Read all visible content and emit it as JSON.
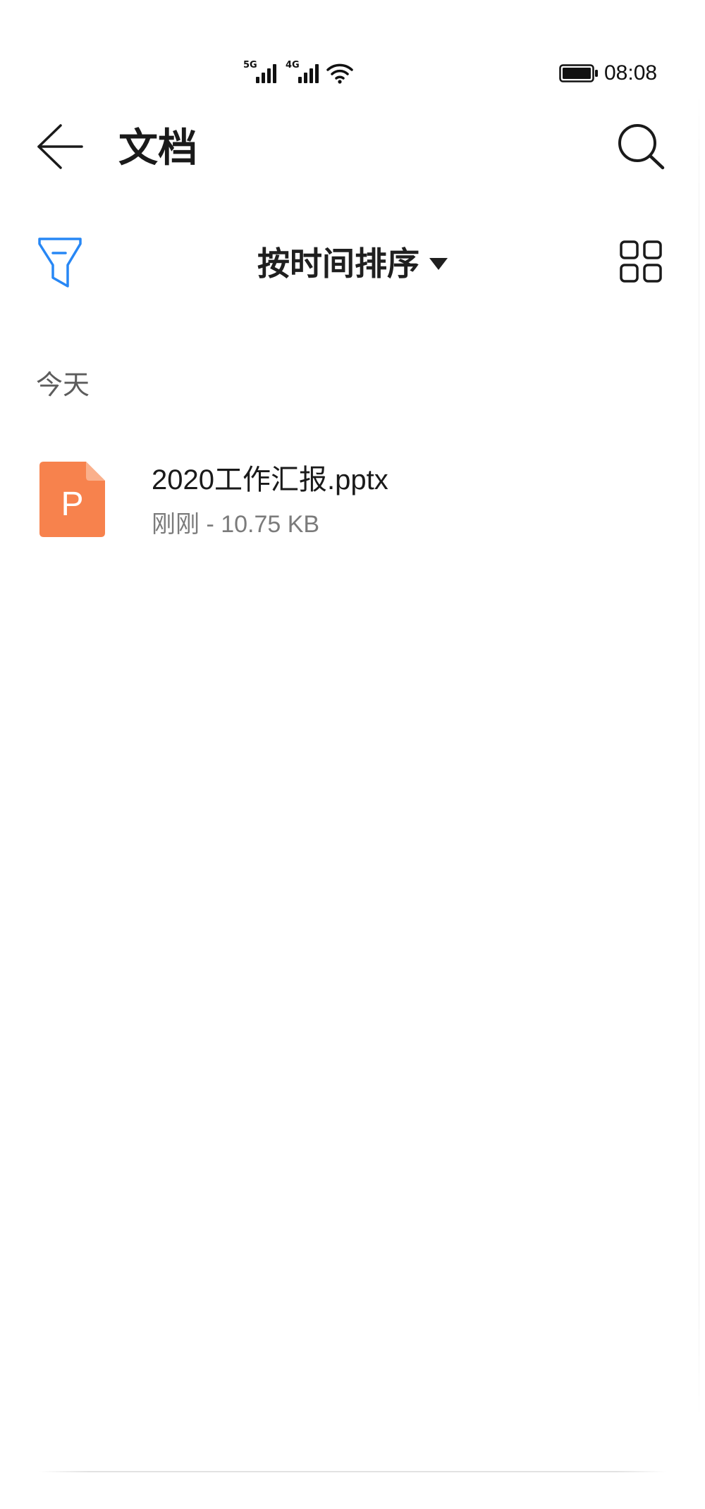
{
  "status_bar": {
    "network_primary": "5G",
    "network_secondary": "4G",
    "time": "08:08",
    "icons": [
      "signal-icon",
      "wifi-icon",
      "battery-icon"
    ]
  },
  "header": {
    "title": "文档",
    "back_icon": "back-arrow-icon",
    "search_icon": "search-icon"
  },
  "toolbar": {
    "filter_icon": "filter-icon",
    "sort_label": "按时间排序",
    "sort_indicator_icon": "dropdown-triangle-icon",
    "view_toggle_icon": "grid-view-icon"
  },
  "sections": [
    {
      "label": "今天",
      "files": [
        {
          "name": "2020工作汇报.pptx",
          "meta": "刚刚 - 10.75 KB",
          "type_letter": "P",
          "type_icon": "pptx-file-icon"
        }
      ]
    }
  ],
  "colors": {
    "accent": "#2787f5",
    "pptx": "#f7824d",
    "pptx_fold": "#fab08c",
    "text_primary": "#1a1a1a",
    "text_secondary": "#7b7b7b",
    "background": "#ffffff"
  }
}
